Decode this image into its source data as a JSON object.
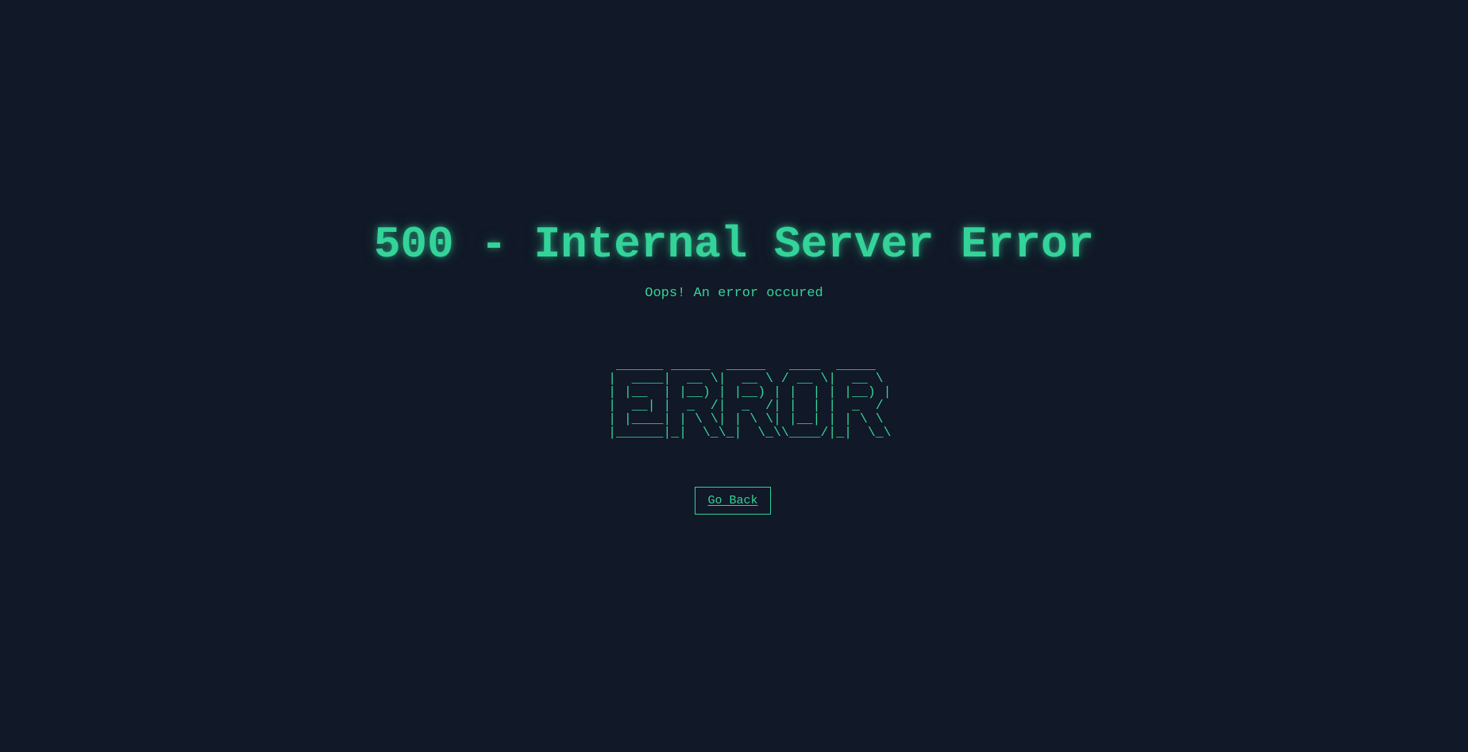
{
  "page": {
    "title": "500 - Internal Server Error",
    "subtitle": "Oops! An error occured",
    "ascii_art": " ______ _____  _____   ____  _____  \n|  ____|  __ \\|  __ \\ / __ \\|  __ \\ \n| |__  | |__) | |__) | |  | | |__) |\n|  __| |  _  /|  _  /| |  | |  _  / \n| |____| | \\ \\| | \\ \\| |__| | | \\ \\ \n|______|_|  \\_\\_|  \\_\\\\____/|_|  \\_\\",
    "go_back_label": "Go Back"
  },
  "colors": {
    "background": "#111827",
    "accent": "#34d399"
  }
}
